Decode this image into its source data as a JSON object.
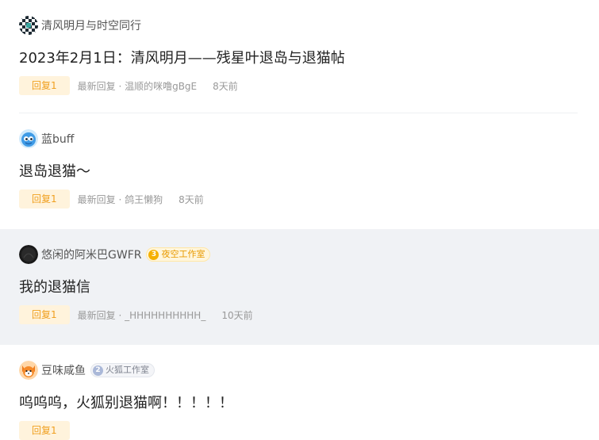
{
  "posts": [
    {
      "author": "清风明月与时空同行",
      "avatar_icon": "checker-avatar-icon",
      "title": "2023年2月1日：清风明月——残星叶退岛与退猫帖",
      "reply_label": "回复1",
      "latest_reply": "最新回复 · 温顺的咪噜gBgE",
      "time": "8天前"
    },
    {
      "author": "蓝buff",
      "avatar_icon": "blue-creature-avatar-icon",
      "title": "退岛退猫～",
      "reply_label": "回复1",
      "latest_reply": "最新回复 · 鸽王懒狗",
      "time": "8天前"
    },
    {
      "author": "悠闲的阿米巴GWFR",
      "avatar_icon": "dark-avatar-icon",
      "badge": {
        "level": "3",
        "name": "夜空工作室"
      },
      "title": "我的退猫信",
      "reply_label": "回复1",
      "latest_reply": "最新回复 · _HHHHHHHHHH_",
      "time": "10天前"
    },
    {
      "author": "豆味咸鱼",
      "avatar_icon": "fox-avatar-icon",
      "badge": {
        "level": "2",
        "name": "火狐工作室"
      },
      "title": "呜呜呜，火狐别退猫啊！！！！！",
      "reply_label": "回复1"
    }
  ],
  "colors": {
    "highlight_bg": "#f0f2f5",
    "reply_tag_bg": "#fff3dc",
    "reply_tag_text": "#f0a020",
    "gold_badge": "#f5b000",
    "silver_badge": "#aab8d8"
  }
}
